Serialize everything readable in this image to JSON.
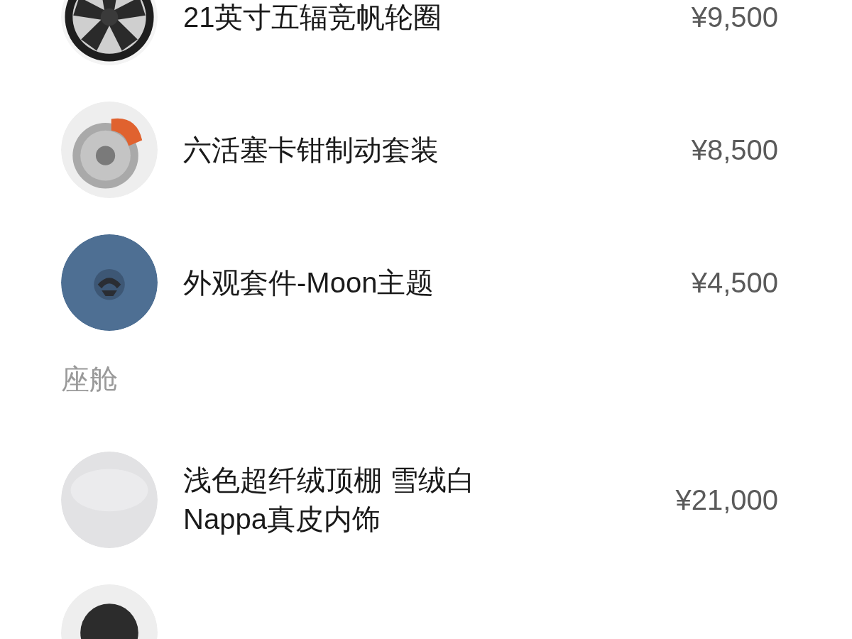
{
  "sections": [
    {
      "items": [
        {
          "kind": "product",
          "name": "21英寸五辐竞帆轮圈",
          "price": "¥9,500"
        },
        {
          "kind": "product",
          "name": "六活塞卡钳制动套装",
          "price": "¥8,500"
        },
        {
          "kind": "product",
          "name": "外观套件-Moon主题",
          "price": "¥4,500"
        }
      ]
    },
    {
      "title": "座舱",
      "items": [
        {
          "kind": "product",
          "name": "浅色超纤绒顶棚 雪绒白 Nappa真皮内饰",
          "price": "¥21,000"
        },
        {
          "kind": "picture"
        }
      ]
    }
  ]
}
